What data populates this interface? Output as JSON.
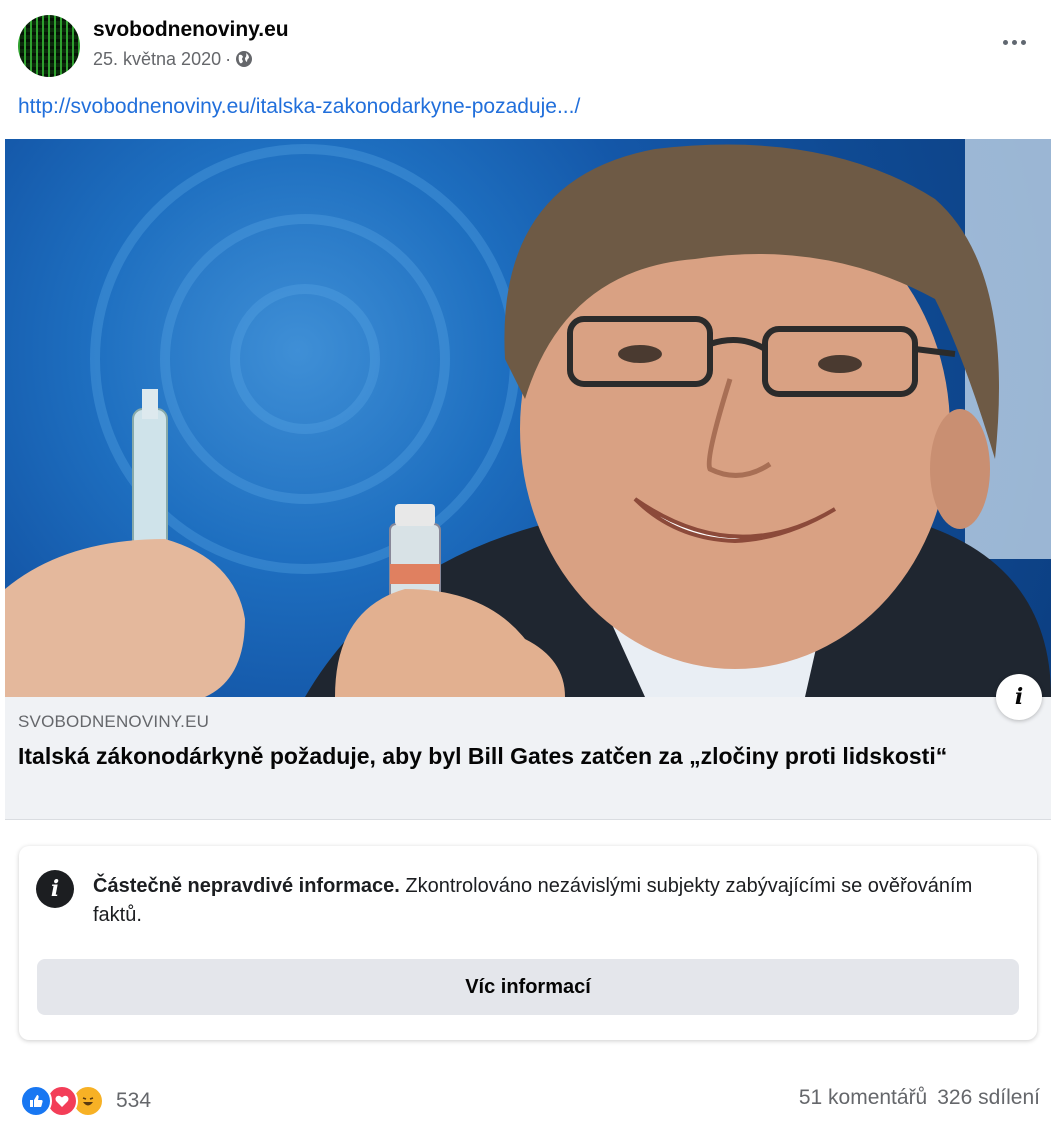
{
  "post": {
    "page_name": "svobodnenoviny.eu",
    "date": "25. května 2020",
    "separator": "·",
    "link_text": "http://svobodnenoviny.eu/italska-zakonodarkyne-pozaduje.../"
  },
  "preview": {
    "domain": "SVOBODNENOVINY.EU",
    "title": "Italská zákonodárkyně požaduje, aby byl Bill Gates zatčen za „zločiny proti lidskosti“"
  },
  "factcheck": {
    "heading": "Částečně nepravdivé informace.",
    "body": " Zkontrolováno nezávislými subjekty zabývajícími se ověřováním faktů.",
    "button_label": "Víc informací"
  },
  "footer": {
    "reaction_count": "534",
    "comments": "51 komentářů",
    "shares": "326 sdílení"
  },
  "icons": {
    "info": "i",
    "more": "more-icon",
    "globe": "globe-icon"
  },
  "colors": {
    "link": "#216fdb",
    "like": "#1877f2",
    "love": "#f33e58",
    "haha": "#f7b125"
  }
}
